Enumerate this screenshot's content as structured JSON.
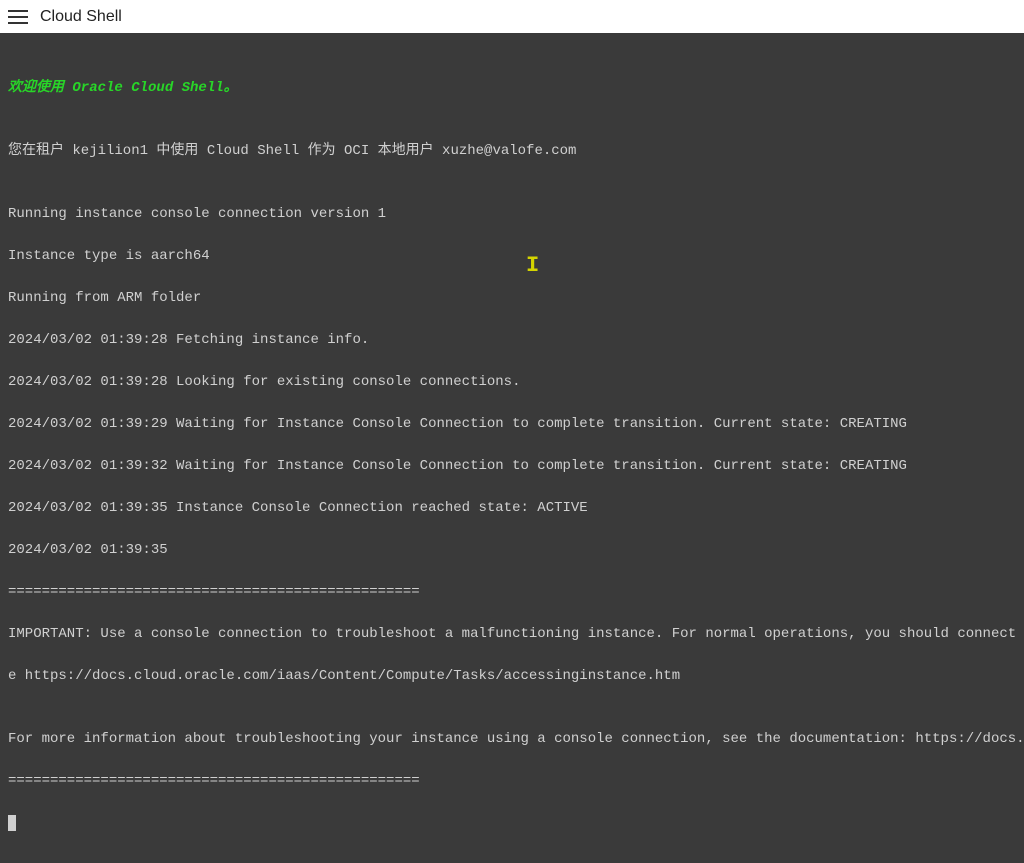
{
  "header": {
    "title": "Cloud Shell"
  },
  "terminal": {
    "welcome": "欢迎使用 Oracle Cloud Shell。",
    "tenant_line": "您在租户 kejilion1 中使用 Cloud Shell 作为 OCI 本地用户 xuzhe@valofe.com",
    "lines": [
      "Running instance console connection version 1",
      "Instance type is aarch64",
      "Running from ARM folder",
      "2024/03/02 01:39:28 Fetching instance info.",
      "2024/03/02 01:39:28 Looking for existing console connections.",
      "2024/03/02 01:39:29 Waiting for Instance Console Connection to complete transition. Current state: CREATING",
      "2024/03/02 01:39:32 Waiting for Instance Console Connection to complete transition. Current state: CREATING",
      "2024/03/02 01:39:35 Instance Console Connection reached state: ACTIVE",
      "2024/03/02 01:39:35",
      "=================================================",
      "IMPORTANT: Use a console connection to troubleshoot a malfunctioning instance. For normal operations, you should connect t",
      "e https://docs.cloud.oracle.com/iaas/Content/Compute/Tasks/accessinginstance.htm",
      "",
      "For more information about troubleshooting your instance using a console connection, see the documentation: https://docs.c",
      "================================================="
    ]
  }
}
